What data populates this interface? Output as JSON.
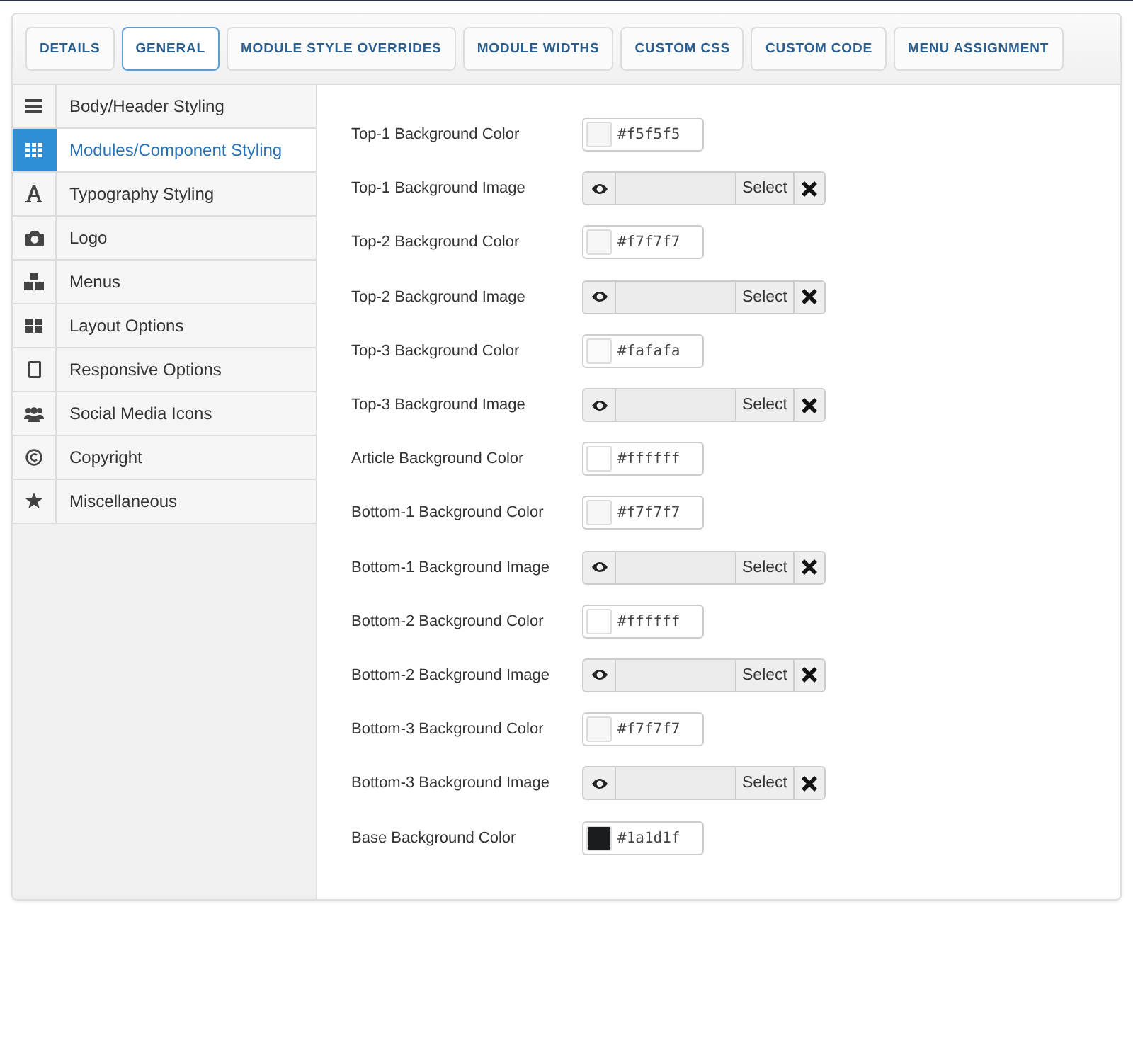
{
  "tabs": [
    {
      "label": "DETAILS",
      "selected": false
    },
    {
      "label": "GENERAL",
      "selected": true
    },
    {
      "label": "MODULE STYLE OVERRIDES",
      "selected": false
    },
    {
      "label": "MODULE WIDTHS",
      "selected": false
    },
    {
      "label": "CUSTOM CSS",
      "selected": false
    },
    {
      "label": "CUSTOM CODE",
      "selected": false
    },
    {
      "label": "MENU ASSIGNMENT",
      "selected": false
    }
  ],
  "sidebar": {
    "items": [
      {
        "label": "Body/Header Styling",
        "selected": false
      },
      {
        "label": "Modules/Component Styling",
        "selected": true
      },
      {
        "label": "Typography Styling",
        "selected": false
      },
      {
        "label": "Logo",
        "selected": false
      },
      {
        "label": "Menus",
        "selected": false
      },
      {
        "label": "Layout Options",
        "selected": false
      },
      {
        "label": "Responsive Options",
        "selected": false
      },
      {
        "label": "Social Media Icons",
        "selected": false
      },
      {
        "label": "Copyright",
        "selected": false
      },
      {
        "label": "Miscellaneous",
        "selected": false
      }
    ]
  },
  "fields": [
    {
      "kind": "color",
      "label": "Top-1 Background Color",
      "value": "#f5f5f5",
      "color": "#f5f5f5"
    },
    {
      "kind": "image",
      "label": "Top-1 Background Image",
      "button": "Select"
    },
    {
      "kind": "color",
      "label": "Top-2 Background Color",
      "value": "#f7f7f7",
      "color": "#f7f7f7"
    },
    {
      "kind": "image",
      "label": "Top-2 Background Image",
      "button": "Select"
    },
    {
      "kind": "color",
      "label": "Top-3 Background Color",
      "value": "#fafafa",
      "color": "#fafafa"
    },
    {
      "kind": "image",
      "label": "Top-3 Background Image",
      "button": "Select"
    },
    {
      "kind": "color",
      "label": "Article Background Color",
      "value": "#ffffff",
      "color": "#ffffff"
    },
    {
      "kind": "color",
      "label": "Bottom-1 Background Color",
      "value": "#f7f7f7",
      "color": "#f7f7f7"
    },
    {
      "kind": "image",
      "label": "Bottom-1 Background Image",
      "button": "Select"
    },
    {
      "kind": "color",
      "label": "Bottom-2 Background Color",
      "value": "#ffffff",
      "color": "#ffffff"
    },
    {
      "kind": "image",
      "label": "Bottom-2 Background Image",
      "button": "Select"
    },
    {
      "kind": "color",
      "label": "Bottom-3 Background Color",
      "value": "#f7f7f7",
      "color": "#f7f7f7"
    },
    {
      "kind": "image",
      "label": "Bottom-3 Background Image",
      "button": "Select"
    },
    {
      "kind": "color",
      "label": "Base Background Color",
      "value": "#1a1d1f",
      "color": "#1a1d1f"
    }
  ]
}
